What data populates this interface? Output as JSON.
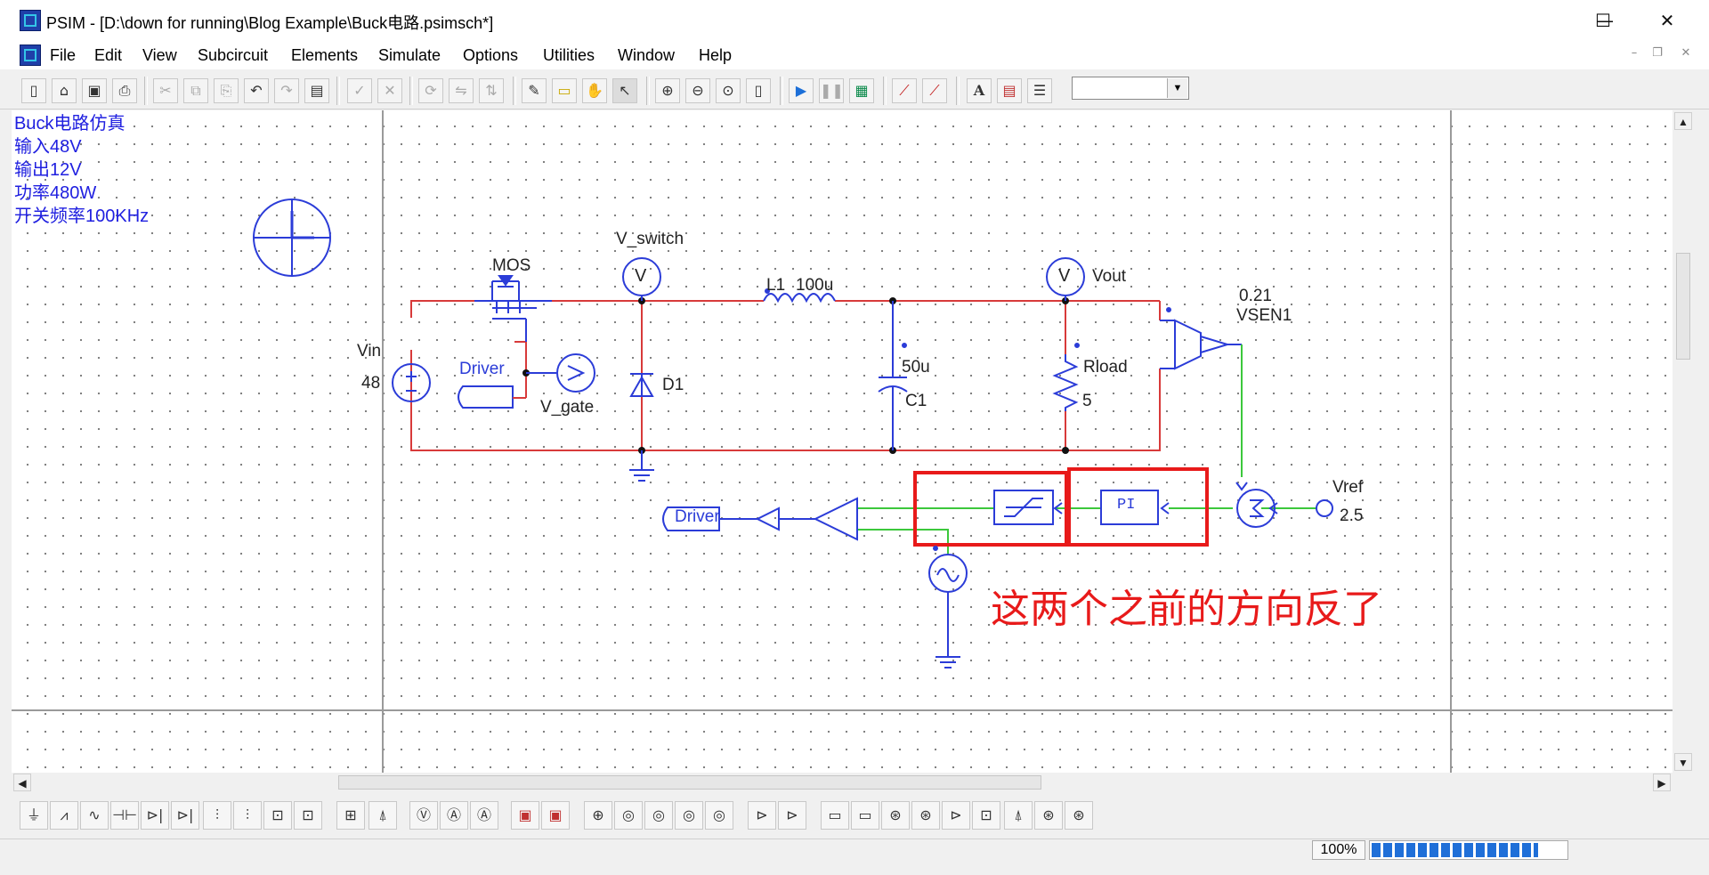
{
  "window": {
    "title": "PSIM - [D:\\down for running\\Blog Example\\Buck电路.psimsch*]",
    "minimize_glyph": "—",
    "maximize_glyph": "☐",
    "close_glyph": "✕"
  },
  "menu": {
    "items": [
      "File",
      "Edit",
      "View",
      "Subcircuit",
      "Elements",
      "Simulate",
      "Options",
      "Utilities",
      "Window",
      "Help"
    ]
  },
  "toolbar": {
    "buttons": [
      "new-file-icon",
      "open-folder-icon",
      "save-icon",
      "print-icon",
      "cut-icon",
      "copy-icon",
      "paste-icon",
      "undo-icon",
      "redo-icon",
      "clipboard-icon",
      "check-icon",
      "cancel-icon",
      "rotate-icon",
      "flip-horizontal-icon",
      "flip-vertical-icon",
      "wire-pencil-icon",
      "label-icon",
      "hand-pan-icon",
      "select-arrow-icon",
      "zoom-in-icon",
      "zoom-out-icon",
      "zoom-fit-icon",
      "page-icon",
      "run-simulation-icon",
      "pause-icon",
      "simview-icon",
      "probe-voltage-icon",
      "probe-current-icon",
      "text-icon",
      "element-list-icon",
      "library-icon"
    ],
    "selected_value": ""
  },
  "schematic": {
    "notes": [
      "Buck电路仿真",
      "输入48V",
      "输出12V",
      "功率480W",
      "开关频率100KHz"
    ],
    "labels": {
      "v_switch": "V_switch",
      "mos": "MOS",
      "l1": "L1",
      "l1_value": "100u",
      "vout": "Vout",
      "vsen_value": "0.21",
      "vsen": "VSEN1",
      "vin": "Vin",
      "vin_value": "48",
      "driver_top": "Driver",
      "v_gate": "V_gate",
      "d1": "D1",
      "c1_value": "50u",
      "c1": "C1",
      "rload": "Rload",
      "rload_value": "5",
      "vref": "Vref",
      "vref_value": "2.5",
      "driver_bottom": "Driver",
      "pi": "PI",
      "voltmeter_glyph": "V",
      "annotation": "这两个之前的方向反了"
    },
    "colors": {
      "wire_power": "#d83a3a",
      "wire_control": "#3cc83c",
      "component": "#2b3cd8",
      "annotation": "#e81a1a",
      "note_text": "#2020e0"
    }
  },
  "status": {
    "zoom": "100%",
    "progress_fraction": 0.85
  }
}
